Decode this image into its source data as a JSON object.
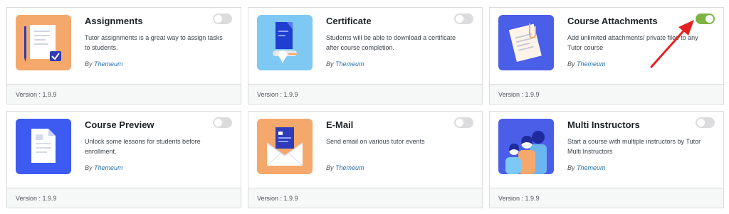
{
  "cards": [
    {
      "title": "Assignments",
      "description": "Tutor assignments is a great way to assign tasks to students.",
      "by_label": "By",
      "author": "Themeum",
      "version": "Version : 1.9.9",
      "enabled": false,
      "icon": "assignment-icon",
      "thumb_color": "#f5a86b"
    },
    {
      "title": "Certificate",
      "description": "Students will be able to download a certificate after course completion.",
      "by_label": "By",
      "author": "Themeum",
      "version": "Version : 1.9.9",
      "enabled": false,
      "icon": "certificate-icon",
      "thumb_color": "#7ec8f4"
    },
    {
      "title": "Course Attachments",
      "description": "Add unlimited attachments/ private files to any Tutor course",
      "by_label": "By",
      "author": "Themeum",
      "version": "Version : 1.9.9",
      "enabled": true,
      "icon": "attachment-icon",
      "thumb_color": "#4a5ee8"
    },
    {
      "title": "Course Preview",
      "description": "Unlock some lessons for students before enrollment.",
      "by_label": "By",
      "author": "Themeum",
      "version": "Version : 1.9.9",
      "enabled": false,
      "icon": "document-preview-icon",
      "thumb_color": "#3d5af1"
    },
    {
      "title": "E-Mail",
      "description": "Send email on various tutor events",
      "by_label": "By",
      "author": "Themeum",
      "version": "Version : 1.9.9",
      "enabled": false,
      "icon": "email-envelope-icon",
      "thumb_color": "#f5a86b"
    },
    {
      "title": "Multi Instructors",
      "description": "Start a course with multiple instructors by Tutor Multi Instructors",
      "by_label": "By",
      "author": "Themeum",
      "version": "Version : 1.9.9",
      "enabled": false,
      "icon": "instructors-icon",
      "thumb_color": "#4a5ee8"
    }
  ],
  "colors": {
    "toggle_on": "#7cb342",
    "toggle_off": "#dcdcde",
    "link": "#2271b1",
    "annotation_arrow": "#e52222"
  }
}
